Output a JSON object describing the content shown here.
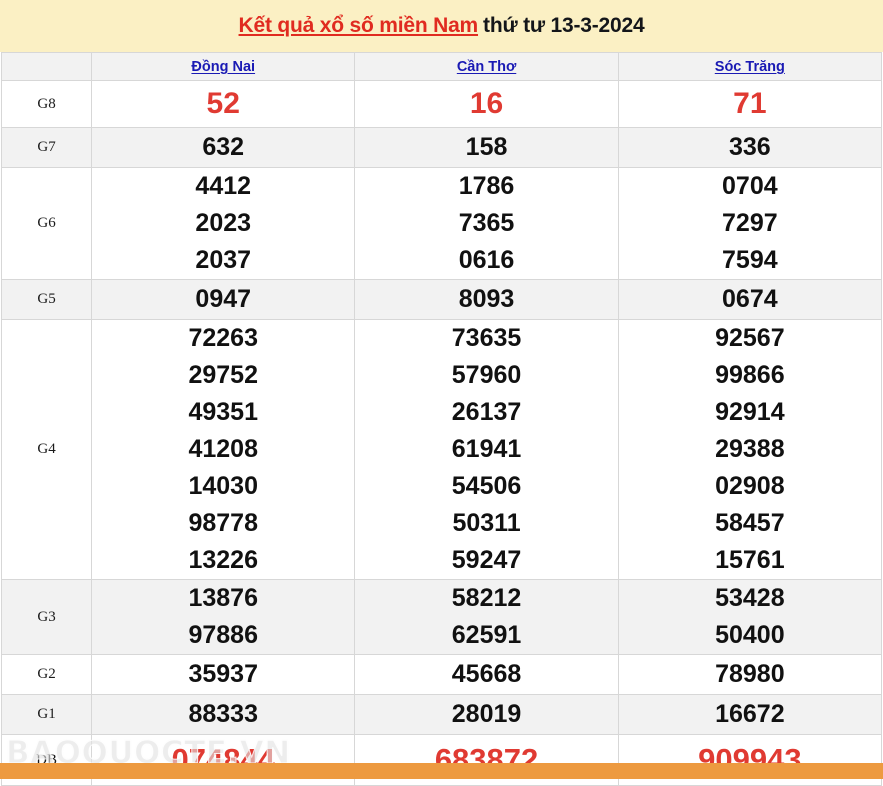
{
  "banner": {
    "link_text": "Kết quả xổ số miền Nam",
    "date_text": "thứ tư 13-3-2024",
    "bg_color": "#fbf0c4",
    "link_color": "#e02b20"
  },
  "table": {
    "corner_label": "",
    "provinces": [
      "Đồng Nai",
      "Cần Thơ",
      "Sóc Trăng"
    ],
    "province_link_color": "#1a1ab4",
    "highlight_color": "#e03a32",
    "rows": [
      {
        "label": "G8",
        "style": "white",
        "highlight": true,
        "values": [
          [
            "52"
          ],
          [
            "16"
          ],
          [
            "71"
          ]
        ]
      },
      {
        "label": "G7",
        "style": "gray",
        "highlight": false,
        "values": [
          [
            "632"
          ],
          [
            "158"
          ],
          [
            "336"
          ]
        ]
      },
      {
        "label": "G6",
        "style": "white",
        "highlight": false,
        "values": [
          [
            "4412",
            "2023",
            "2037"
          ],
          [
            "1786",
            "7365",
            "0616"
          ],
          [
            "0704",
            "7297",
            "7594"
          ]
        ]
      },
      {
        "label": "G5",
        "style": "gray",
        "highlight": false,
        "values": [
          [
            "0947"
          ],
          [
            "8093"
          ],
          [
            "0674"
          ]
        ]
      },
      {
        "label": "G4",
        "style": "white",
        "highlight": false,
        "values": [
          [
            "72263",
            "29752",
            "49351",
            "41208",
            "14030",
            "98778",
            "13226"
          ],
          [
            "73635",
            "57960",
            "26137",
            "61941",
            "54506",
            "50311",
            "59247"
          ],
          [
            "92567",
            "99866",
            "92914",
            "29388",
            "02908",
            "58457",
            "15761"
          ]
        ]
      },
      {
        "label": "G3",
        "style": "gray",
        "highlight": false,
        "values": [
          [
            "13876",
            "97886"
          ],
          [
            "58212",
            "62591"
          ],
          [
            "53428",
            "50400"
          ]
        ]
      },
      {
        "label": "G2",
        "style": "white",
        "highlight": false,
        "values": [
          [
            "35937"
          ],
          [
            "45668"
          ],
          [
            "78980"
          ]
        ]
      },
      {
        "label": "G1",
        "style": "gray",
        "highlight": false,
        "values": [
          [
            "88333"
          ],
          [
            "28019"
          ],
          [
            "16672"
          ]
        ]
      },
      {
        "label": "DB",
        "style": "white",
        "highlight": true,
        "values": [
          [
            "074844"
          ],
          [
            "683872"
          ],
          [
            "909943"
          ]
        ]
      }
    ]
  },
  "watermark": {
    "text": "BAOQUOCTE.VN"
  },
  "bottom_bar": {
    "left_text": "",
    "right_text": "",
    "color": "#ed9a40"
  }
}
